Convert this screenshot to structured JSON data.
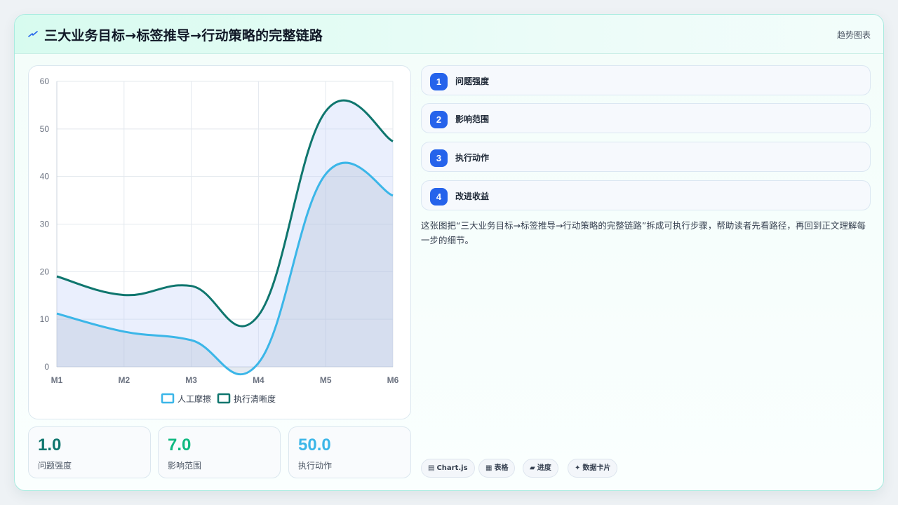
{
  "header": {
    "icon": "lightning-icon",
    "title": "三大业务目标→标签推导→行动策略的完整链路",
    "tag": "趋势图表"
  },
  "chart_data": {
    "type": "area",
    "categories": [
      "M1",
      "M2",
      "M3",
      "M4",
      "M5",
      "M6"
    ],
    "series": [
      {
        "name": "人工摩擦",
        "values": [
          11.2,
          7.4,
          5.6,
          0.8,
          40.5,
          36.0
        ],
        "color": "#3bb6e8"
      },
      {
        "name": "执行清晰度",
        "values": [
          19.0,
          15.1,
          17.0,
          10.8,
          53.7,
          47.4
        ],
        "color": "#0f766e"
      }
    ],
    "ylim": [
      0,
      60
    ],
    "yticks": [
      0,
      10,
      20,
      30,
      40,
      50,
      60
    ],
    "grid": true,
    "legend": "bottom"
  },
  "stats": [
    {
      "value": "1.0",
      "label": "问题强度",
      "color": "#0f766e"
    },
    {
      "value": "7.0",
      "label": "影响范围",
      "color": "#10b981"
    },
    {
      "value": "50.0",
      "label": "执行动作",
      "color": "#3bb6e8"
    }
  ],
  "steps": [
    {
      "num": "1",
      "label": "问题强度"
    },
    {
      "num": "2",
      "label": "影响范围"
    },
    {
      "num": "3",
      "label": "执行动作"
    },
    {
      "num": "4",
      "label": "改进收益"
    }
  ],
  "description": "这张图把“三大业务目标→标签推导→行动策略的完整链路”拆成可执行步骤，帮助读者先看路径，再回到正文理解每一步的细节。",
  "chips": [
    {
      "icon": "▤",
      "label": "Chart.js"
    },
    {
      "icon": "▦",
      "label": "表格"
    },
    {
      "icon": "▰",
      "label": "进度"
    },
    {
      "icon": "✦",
      "label": "数据卡片"
    }
  ]
}
